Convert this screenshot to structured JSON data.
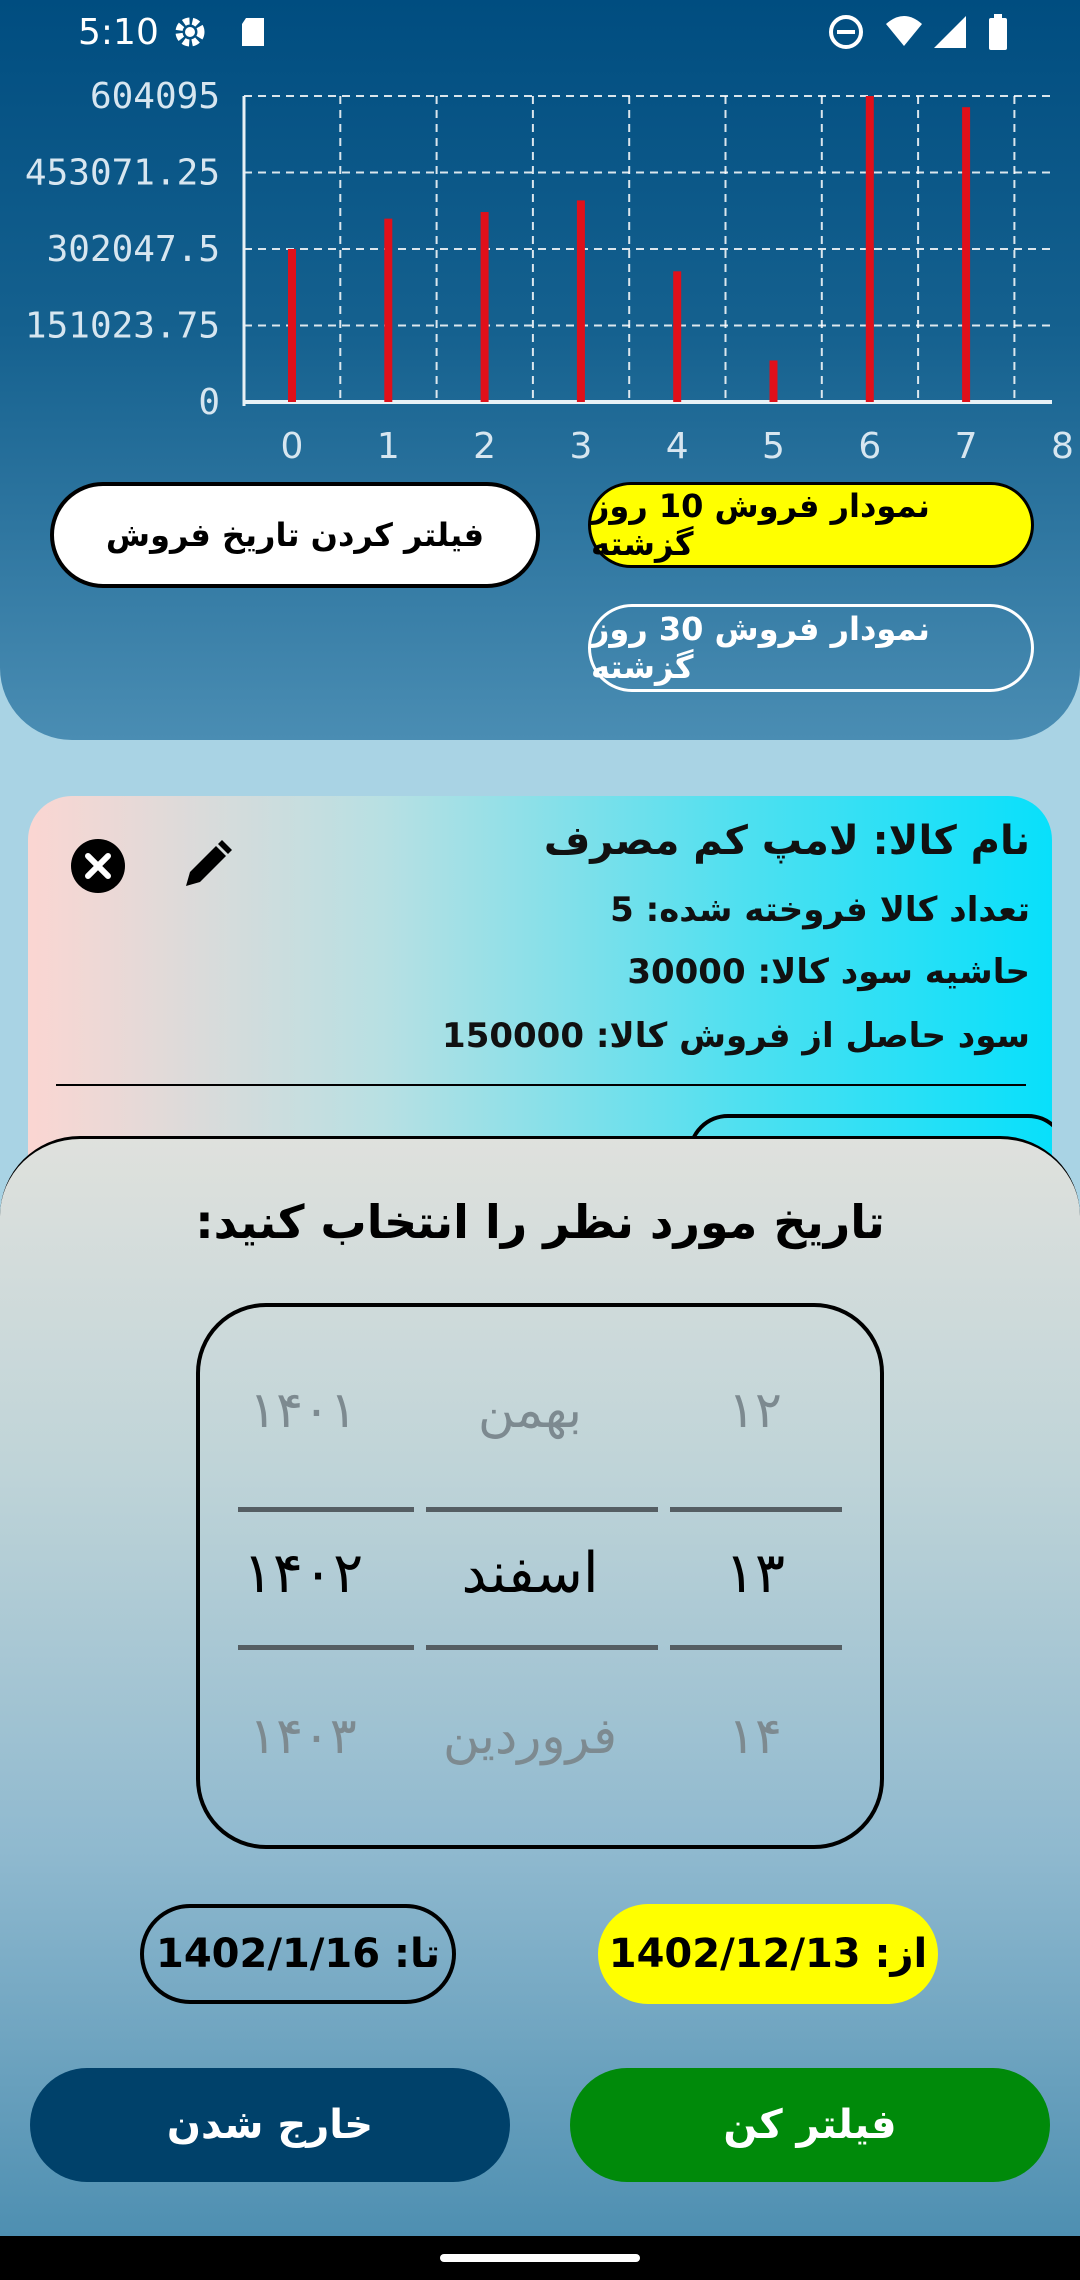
{
  "status_bar": {
    "time": "5:10",
    "icons": [
      "gear-icon",
      "sd-card-icon",
      "dnd-icon",
      "wifi-icon",
      "signal-icon",
      "battery-icon"
    ]
  },
  "chart_data": {
    "type": "bar",
    "categories": [
      "0",
      "1",
      "2",
      "3",
      "4",
      "5",
      "6",
      "7"
    ],
    "values": [
      302047.5,
      362000,
      375000,
      398000,
      258000,
      82000,
      604095,
      582000
    ],
    "xticks": [
      "0",
      "1",
      "2",
      "3",
      "4",
      "5",
      "6",
      "7",
      "8"
    ],
    "yticks": [
      "0",
      "151023.75",
      "302047.5",
      "453071.25",
      "604095"
    ],
    "ylim": [
      0,
      604095
    ],
    "bar_color": "#e0101a",
    "grid": true
  },
  "buttons": {
    "filter_date": "فیلتر کردن تاریخ فروش",
    "sales_10_days": "نمودار فروش 10 روز گزشته",
    "sales_30_days": "نمودار فروش 30 روز گزشته"
  },
  "card": {
    "title": "نام کالا: لامپ  کم مصرف",
    "sold_count": "تعداد کالا فروخته شده: 5",
    "profit_margin": "حاشیه سود کالا: 30000",
    "total_profit": "سود حاصل از فروش کالا: 150000"
  },
  "sheet": {
    "title": "تاریخ مورد نظر را انتخاب کنید:",
    "picker": {
      "years": [
        "۱۴۰۱",
        "۱۴۰۲",
        "۱۴۰۳"
      ],
      "months": [
        "بهمن",
        "اسفند",
        "فروردین"
      ],
      "days": [
        "۱۲",
        "۱۳",
        "۱۴"
      ]
    },
    "from_label": "از: 1402/12/13",
    "to_label": "تا: 1402/1/16",
    "filter_button": "فیلتر کن",
    "exit_button": "خارج شدن"
  },
  "colors": {
    "accent_yellow": "#ffff00",
    "exit_blue": "#00416a",
    "filter_green": "#008a0a"
  }
}
